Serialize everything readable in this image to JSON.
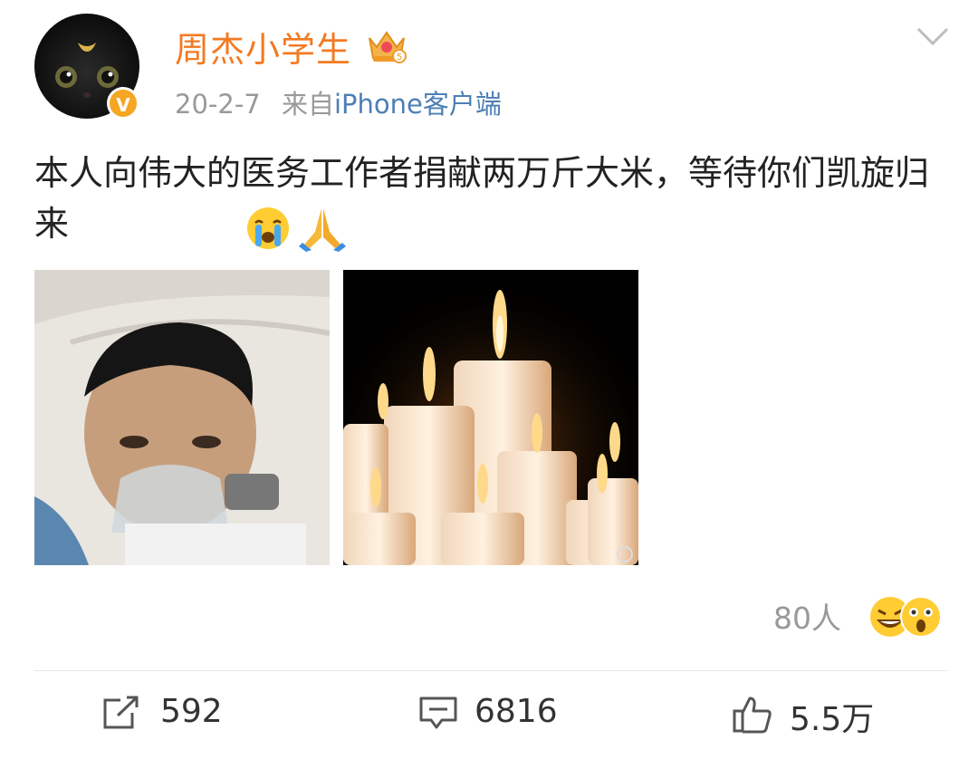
{
  "post": {
    "username": "周杰小学生",
    "verified_badge": "V",
    "date": "20-2-7",
    "source_prefix": "来自",
    "source": "iPhone客户端",
    "text": "本人向伟大的医务工作者捐献两万斤大米，等待你们凯旋归来",
    "emoji_icons": [
      "crying-face-icon",
      "folded-hands-icon"
    ],
    "images": [
      {
        "name": "image-doctor-in-hospital-bed"
      },
      {
        "name": "image-candles"
      }
    ]
  },
  "reactions": {
    "count_label": "80人",
    "icons": [
      "grinning-face-icon",
      "astonished-face-icon"
    ]
  },
  "actions": {
    "repost": {
      "icon": "repost-icon",
      "count": "592"
    },
    "comment": {
      "icon": "comment-icon",
      "count": "6816"
    },
    "like": {
      "icon": "thumbs-up-icon",
      "count": "5.5万"
    }
  },
  "colors": {
    "username": "#f37a22",
    "source_link": "#4d7fb5",
    "verified_badge": "#f5a623",
    "meta_text": "#999999"
  }
}
